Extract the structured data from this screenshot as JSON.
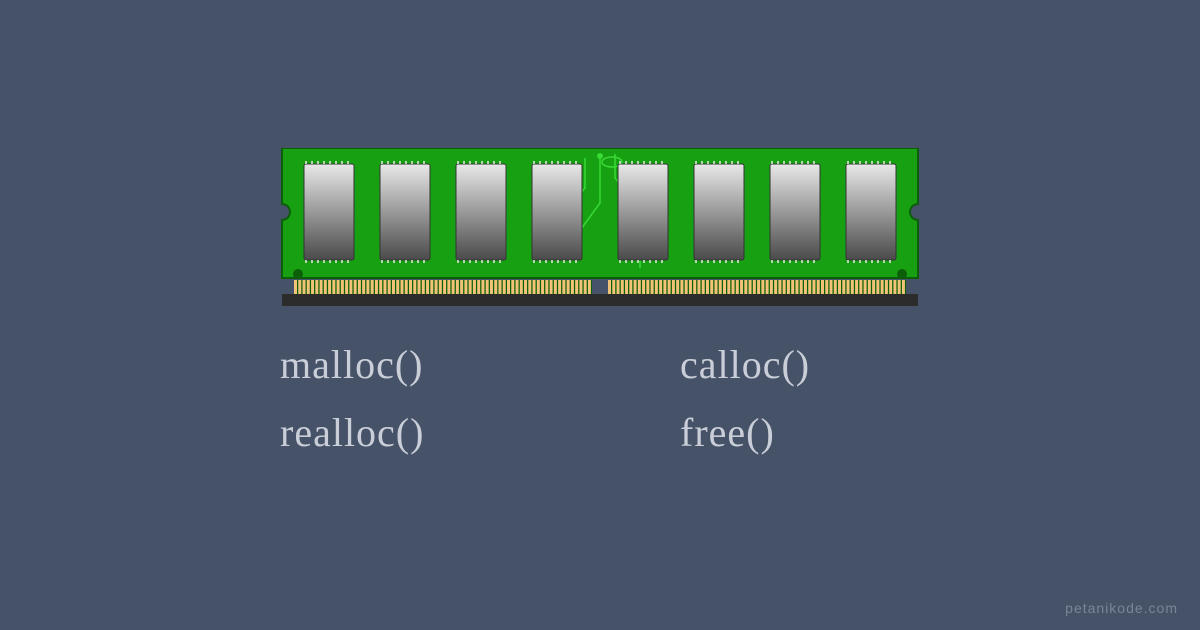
{
  "functions": {
    "top_left": "malloc()",
    "top_right": "calloc()",
    "bottom_left": "realloc()",
    "bottom_right": "free()"
  },
  "watermark": "petanikode.com",
  "colors": {
    "background": "#465268",
    "text": "#c9ced8",
    "watermark": "#7c8597",
    "pcb": "#17a012",
    "pcb_dark": "#0f7a0d",
    "chip_light": "#d8d8d8",
    "chip_dark": "#5a5a5a",
    "contacts": "#f2c278"
  },
  "ram": {
    "chip_count": 8
  }
}
